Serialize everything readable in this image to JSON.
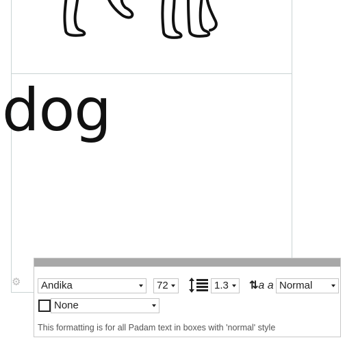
{
  "card_text": {
    "word": "dog"
  },
  "toolbar": {
    "font": {
      "selected": "Andika"
    },
    "size": {
      "selected": "72"
    },
    "line_spacing": {
      "selected": "1.3"
    },
    "text_style": {
      "icon_label": "a a",
      "selected": "Normal"
    },
    "border": {
      "selected": "None",
      "checked": false
    },
    "note": "This formatting is for all Padam text in boxes with 'normal' style"
  },
  "icons": [
    "settings-gear-icon",
    "line-spacing-icon",
    "text-style-icon",
    "checkbox",
    "chevron-down-icon"
  ],
  "colors": {
    "toolbar_header": "#a8a8a8",
    "panel_border": "#c9d3d3",
    "text": "#111111"
  }
}
